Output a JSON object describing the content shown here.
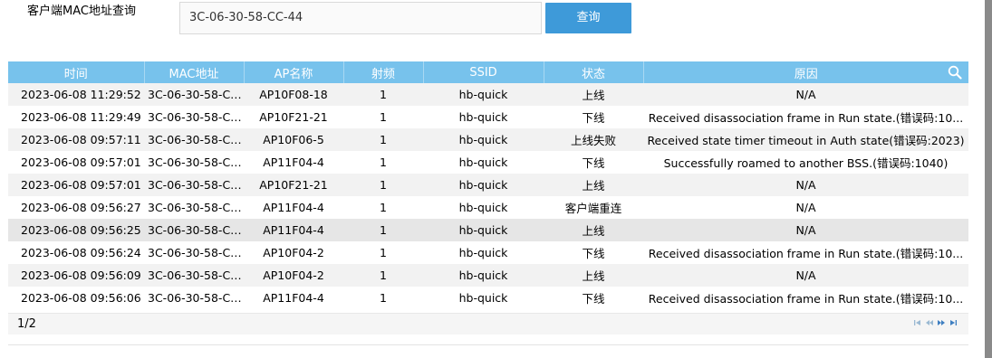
{
  "query": {
    "label": "客户端MAC地址查询",
    "mac_value": "3C-06-30-58-CC-44",
    "button_label": "查询"
  },
  "table": {
    "headers": [
      "时间",
      "MAC地址",
      "AP名称",
      "射频",
      "SSID",
      "状态",
      "原因"
    ],
    "rows": [
      [
        "2023-06-08 11:29:52",
        "3C-06-30-58-CC-...",
        "AP10F08-18",
        "1",
        "hb-quick",
        "上线",
        "N/A"
      ],
      [
        "2023-06-08 11:29:49",
        "3C-06-30-58-CC-...",
        "AP10F21-21",
        "1",
        "hb-quick",
        "下线",
        "Received disassociation frame in Run state.(错误码:10..."
      ],
      [
        "2023-06-08 09:57:11",
        "3C-06-30-58-CC-...",
        "AP10F06-5",
        "1",
        "hb-quick",
        "上线失败",
        "Received state timer timeout in Auth state(错误码:2023)"
      ],
      [
        "2023-06-08 09:57:01",
        "3C-06-30-58-CC-...",
        "AP11F04-4",
        "1",
        "hb-quick",
        "下线",
        "Successfully roamed to another BSS.(错误码:1040)"
      ],
      [
        "2023-06-08 09:57:01",
        "3C-06-30-58-CC-...",
        "AP10F21-21",
        "1",
        "hb-quick",
        "上线",
        "N/A"
      ],
      [
        "2023-06-08 09:56:27",
        "3C-06-30-58-CC-...",
        "AP11F04-4",
        "1",
        "hb-quick",
        "客户端重连",
        "N/A"
      ],
      [
        "2023-06-08 09:56:25",
        "3C-06-30-58-CC-...",
        "AP11F04-4",
        "1",
        "hb-quick",
        "上线",
        "N/A"
      ],
      [
        "2023-06-08 09:56:24",
        "3C-06-30-58-CC-...",
        "AP10F04-2",
        "1",
        "hb-quick",
        "下线",
        "Received disassociation frame in Run state.(错误码:10..."
      ],
      [
        "2023-06-08 09:56:09",
        "3C-06-30-58-CC-...",
        "AP10F04-2",
        "1",
        "hb-quick",
        "上线",
        "N/A"
      ],
      [
        "2023-06-08 09:56:06",
        "3C-06-30-58-CC-...",
        "AP11F04-4",
        "1",
        "hb-quick",
        "下线",
        "Received disassociation frame in Run state.(错误码:10..."
      ]
    ],
    "search_icon": "search-icon"
  },
  "pager": {
    "page_text": "1/2",
    "controls": [
      "first-page-icon",
      "prev-page-icon",
      "next-page-icon",
      "last-page-icon"
    ]
  },
  "colors": {
    "header_bg": "#77c2ec",
    "button_bg": "#3e9ad9",
    "row_alt_bg": "#f2f2f2",
    "row_highlight_bg": "#e6e6e6"
  }
}
